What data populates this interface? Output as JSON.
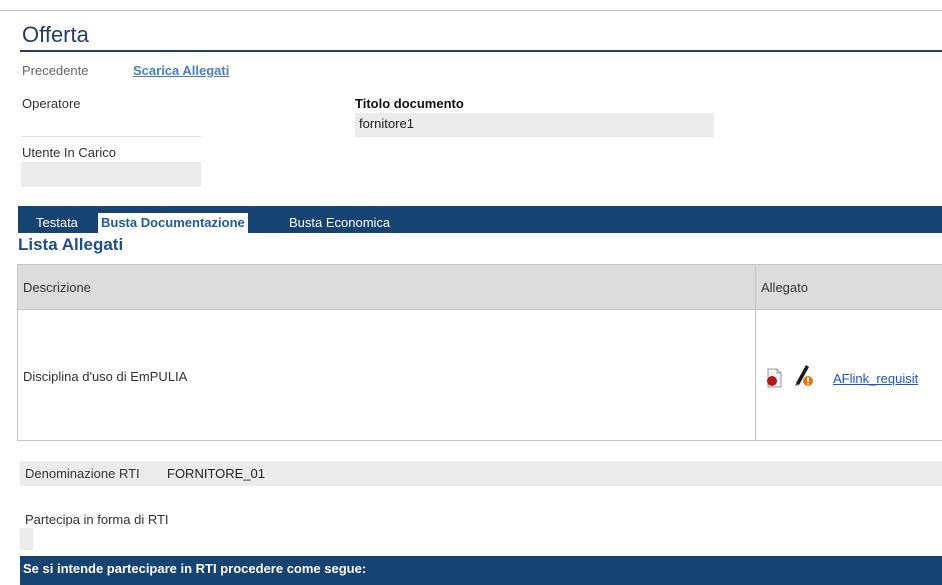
{
  "page": {
    "title": "Offerta"
  },
  "toolbar": {
    "previous": "Precedente",
    "download_attachments": "Scarica Allegati"
  },
  "header": {
    "operator_label": "Operatore",
    "doc_title_label": "Titolo documento",
    "doc_title_value": "fornitore1",
    "user_in_charge_label": "Utente In Carico",
    "user_in_charge_value": ""
  },
  "tabs": [
    {
      "label": "Testata",
      "active": false
    },
    {
      "label": "Busta Documentazione",
      "active": true
    },
    {
      "label": "Busta Economica",
      "active": false
    }
  ],
  "attachments": {
    "title": "Lista Allegati",
    "columns": [
      "Descrizione",
      "Allegato"
    ],
    "rows": [
      {
        "description": "Disciplina d'uso di EmPULIA",
        "file_name": "AFlink_requisit",
        "icons": [
          "pdf-file-icon",
          "signature-warning-icon"
        ]
      }
    ]
  },
  "rti": {
    "name_label": "Denominazione RTI",
    "name_value": "FORNITORE_01",
    "participate_label": "Partecipa in forma di RTI",
    "participate_value": "",
    "banner": "Se si intende partecipare in RTI procedere come segue:"
  },
  "colors": {
    "accent": "#164472",
    "title": "#1e3e66",
    "link": "#1a56c4",
    "field_bg": "#ebebeb"
  }
}
